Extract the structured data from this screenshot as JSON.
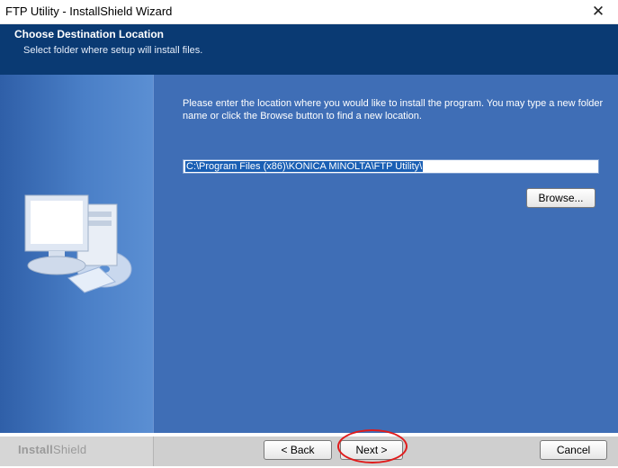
{
  "window": {
    "title": "FTP Utility - InstallShield Wizard",
    "close_label": "✕"
  },
  "header": {
    "title": "Choose Destination Location",
    "subtitle": "Select folder where setup will install files."
  },
  "main": {
    "message": "Please enter the location where you would like to install the program.  You may type a new folder name or click the Browse button to find a new location.",
    "path_value": "C:\\Program Files (x86)\\KONICA MINOLTA\\FTP Utility\\",
    "browse_label": "Browse..."
  },
  "footer": {
    "brand_bold": "Install",
    "brand_light": "Shield",
    "back_label": "< Back",
    "next_label": "Next >",
    "cancel_label": "Cancel"
  },
  "annotation": {
    "color": "#e01b1b"
  },
  "colors": {
    "header_bg": "#0a3a73",
    "main_bg": "#3f6eb6",
    "selection": "#1a5fb4"
  }
}
